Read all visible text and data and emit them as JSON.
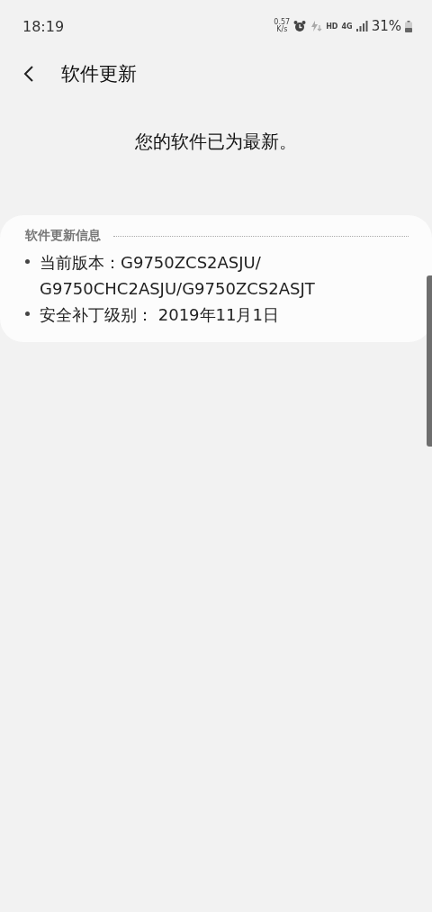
{
  "status_bar": {
    "time": "18:19",
    "net_speed_value": "0.57",
    "net_speed_unit": "K/s",
    "hd": "HD",
    "network": "4G",
    "battery": "31%"
  },
  "header": {
    "title": "软件更新"
  },
  "message": "您的软件已为最新。",
  "info_card": {
    "heading": "软件更新信息",
    "items": [
      {
        "lines": [
          "当前版本：G9750ZCS2ASJU/",
          "G9750CHC2ASJU/G9750ZCS2ASJT"
        ]
      },
      {
        "lines": [
          "安全补丁级别： 2019年11月1日"
        ]
      }
    ]
  }
}
